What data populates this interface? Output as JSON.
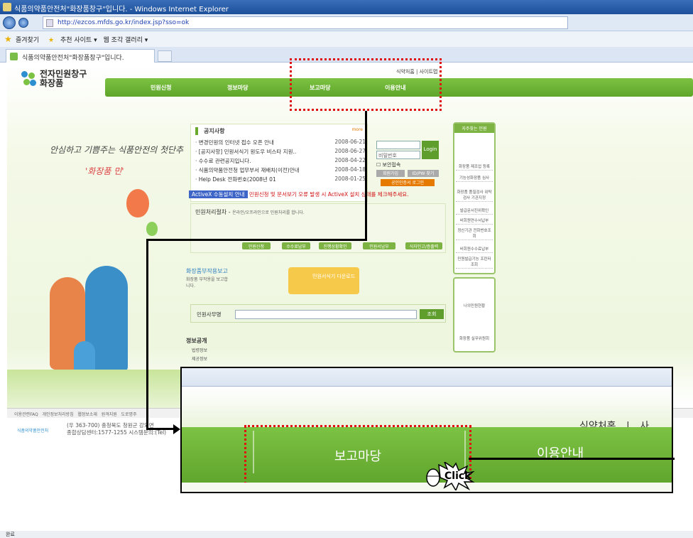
{
  "browser": {
    "title": "식품의약품안전처\"화장품창구\"입니다. - Windows Internet Explorer",
    "url": "http://ezcos.mfds.go.kr/index.jsp?sso=ok",
    "favorites": "즐겨찾기",
    "fav_items": [
      "추천 사이트 ▾",
      "웹 조각 갤러리 ▾"
    ],
    "tab_title": "식품의약품안전처\"화장품창구\"입니다.",
    "status": "완료"
  },
  "site": {
    "logo_line1": "전자민원창구",
    "logo_line2": "화장품",
    "top_links": [
      "식약처홈",
      "사이트맵"
    ],
    "nav": [
      "민원신청",
      "정보마당",
      "보고마당",
      "이용안내"
    ],
    "slogan": "안심하고 기쁨주는 식품안전의 첫단추",
    "slogan2": "'화장품 민'"
  },
  "notice": {
    "title": "공지사항",
    "more": "more",
    "items": [
      {
        "text": "변경민원의 인터넷 접수 오픈 안내",
        "date": "2008-06-21"
      },
      {
        "text": "[공지사항] 민원서식기 원도우 비스타 지원..",
        "date": "2008-06-27"
      },
      {
        "text": "수수료 관련공지입니다.",
        "date": "2008-04-22"
      },
      {
        "text": "식품의약품안전청 업무부서 재배치(이전)안내",
        "date": "2008-04-18"
      },
      {
        "text": "Help Desk 전화번호(2008년 01",
        "date": "2008-01-25"
      }
    ]
  },
  "activex": {
    "label": "ActiveX 수동설치 안내",
    "warning": "민원신청 및 문서보기 오류 발생 시 ActiveX 설치 상태를 체크해주세요."
  },
  "login": {
    "pw_placeholder": "비밀번호",
    "button": "Login",
    "secure": "보안접속",
    "join": "회원가입",
    "find": "ID/PW 찾기",
    "cert": "공인인증서 로그인"
  },
  "process": {
    "title": "민원처리절차",
    "subtitle": "온라인/오프라인으로 민원처리를 합니다.",
    "steps": [
      "민원신청",
      "수수료납부",
      "진행상황확인",
      "민원서납부",
      "식자인고/증출력"
    ]
  },
  "report": {
    "title": "화장품부작용보고",
    "desc": "화장품 부작용을 보고합니다.",
    "download": "민원서식기 다운로드"
  },
  "search": {
    "label": "민원사무명",
    "button": "조회"
  },
  "info": {
    "title": "정보공개",
    "items": [
      "법령정보",
      "제공정보"
    ]
  },
  "side": {
    "title": "자주찾는 민원",
    "items": [
      "화장품 제조업 등록",
      "기능성화장품 심사",
      "화장품 품질검사 위탁검사 기관지정",
      "발급문서진위확인",
      "비회원연수서납부",
      "정신기관 전화번호조회",
      "비회원수수료납부",
      "민원발급기능 프린터 조회"
    ],
    "box2": [
      "나의민원현황",
      "화장품 실무위원회"
    ]
  },
  "footer": {
    "links": [
      "이용관련FAQ",
      "개인정보처리방침",
      "웹정보소재",
      "원격지원",
      "도로명주"
    ],
    "address": "(우 363-700) 충청북도 청원군 강외면",
    "contact": "종합상담센터:1577-1255  시스템문의:(Tel)",
    "brand": "식품의약품안전처"
  },
  "zoom": {
    "links": [
      "식약처홈",
      "|",
      "사"
    ],
    "button": "보고마당",
    "guide": "이용안내",
    "click": "Click"
  }
}
